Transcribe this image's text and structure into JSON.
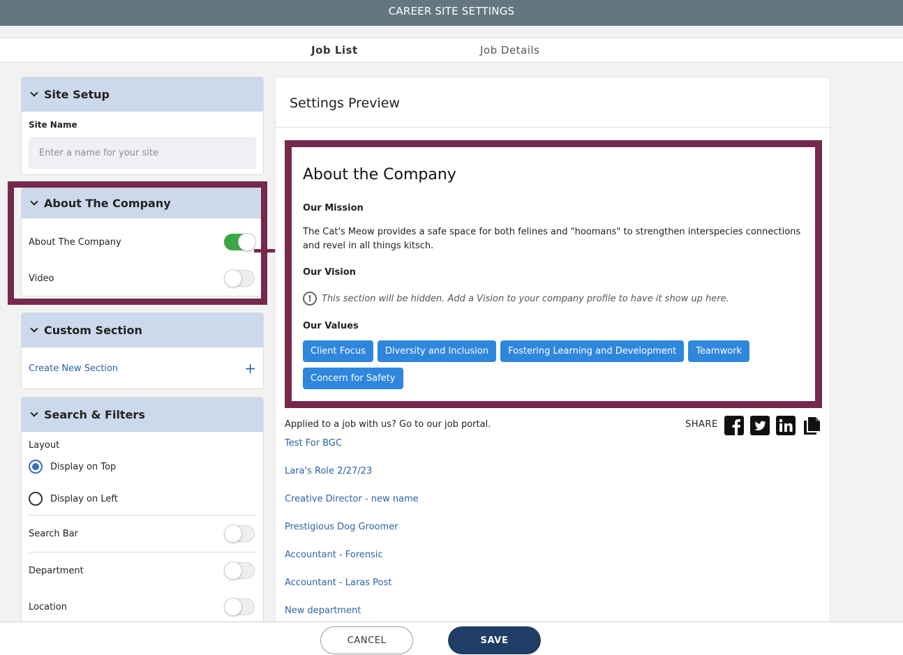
{
  "header": {
    "title": "CAREER SITE SETTINGS"
  },
  "tabs": [
    {
      "label": "Job List",
      "active": true
    },
    {
      "label": "Job Details",
      "active": false
    }
  ],
  "site_setup": {
    "title": "Site Setup",
    "site_name_label": "Site Name",
    "site_name_placeholder": "Enter a name for your site",
    "site_name_value": ""
  },
  "about_panel": {
    "title": "About The Company",
    "items": [
      {
        "label": "About The Company",
        "enabled": true
      },
      {
        "label": "Video",
        "enabled": false
      }
    ]
  },
  "custom_section": {
    "title": "Custom Section",
    "create_label": "Create New Section",
    "plus": "+"
  },
  "search_filters": {
    "title": "Search & Filters",
    "layout_label": "Layout",
    "layout_options": [
      {
        "label": "Display on Top",
        "selected": true
      },
      {
        "label": "Display on Left",
        "selected": false
      }
    ],
    "toggles": [
      {
        "label": "Search Bar",
        "enabled": false
      },
      {
        "label": "Department",
        "enabled": false
      },
      {
        "label": "Location",
        "enabled": false
      }
    ]
  },
  "preview": {
    "title": "Settings Preview",
    "about": {
      "title": "About the Company",
      "mission_heading": "Our Mission",
      "mission_text": "The Cat's Meow provides a safe space for both felines and \"hoomans\" to strengthen interspecies connections and revel in all things kitsch.",
      "vision_heading": "Our Vision",
      "vision_note_icon": "!",
      "vision_note": "This section will be hidden. Add a Vision to your company profile to have it show up here.",
      "values_heading": "Our Values",
      "values": [
        "Client Focus",
        "Diversity and Inclusion",
        "Fostering Learning and Development",
        "Teamwork",
        "Concern for Safety"
      ]
    },
    "portal_text": "Applied to a job with us? Go to our job portal.",
    "share_label": "SHARE",
    "social_icons": [
      "facebook-icon",
      "twitter-icon",
      "linkedin-icon",
      "copy-icon"
    ],
    "jobs": [
      "Test For BGC",
      "Lara's Role 2/27/23",
      "Creative Director - new name",
      "Prestigious Dog Groomer",
      "Accountant - Forensic",
      "Accountant - Laras Post",
      "New department"
    ]
  },
  "footer": {
    "cancel_label": "CANCEL",
    "save_label": "SAVE"
  },
  "colors": {
    "highlight": "#76294d",
    "toggle_on": "#3aa844",
    "chip": "#2f86dd",
    "save": "#1f3d66",
    "link": "#2b63a6"
  }
}
